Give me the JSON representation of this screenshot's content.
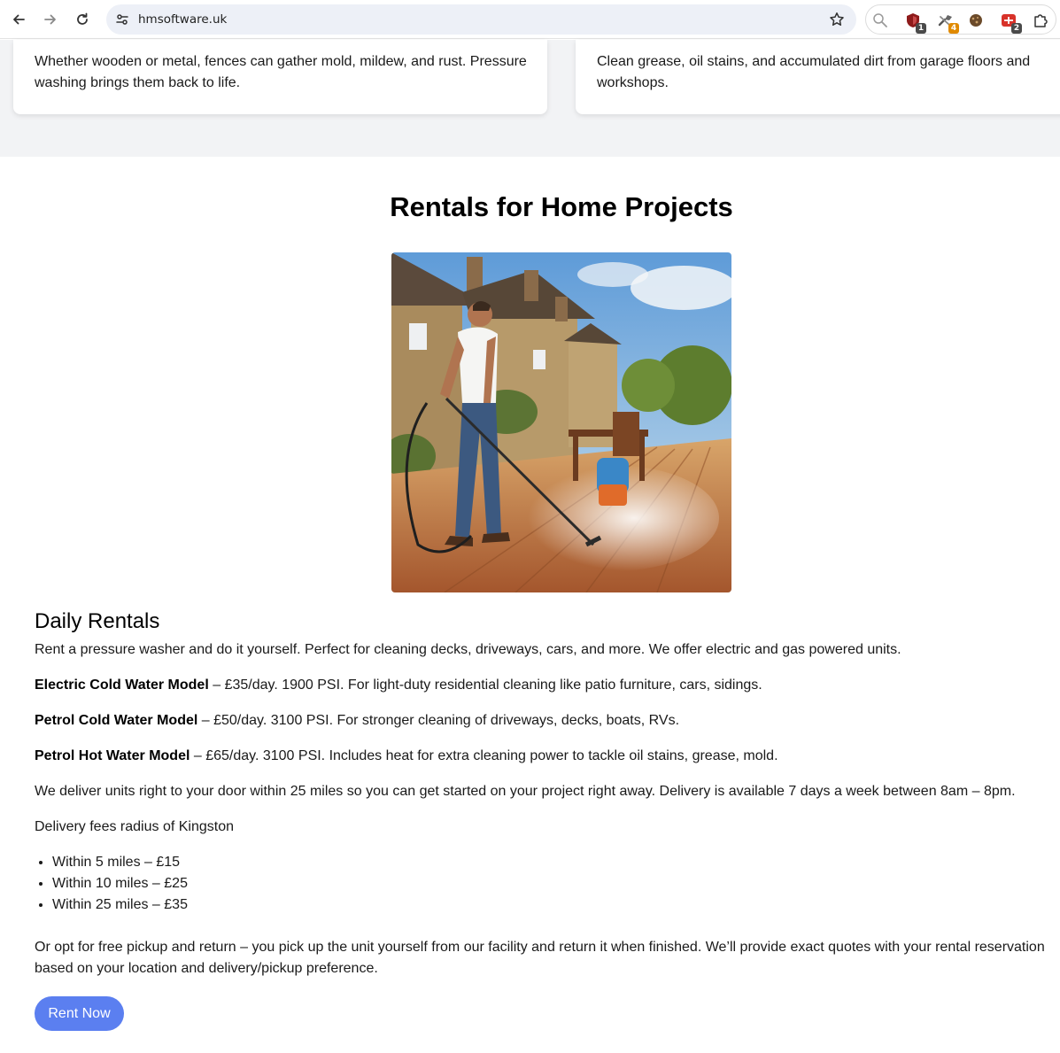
{
  "browser": {
    "url": "hmsoftware.uk",
    "back_icon": "back-arrow-icon",
    "forward_icon": "forward-arrow-icon",
    "reload_icon": "reload-icon",
    "site_info_icon": "site-settings-icon",
    "bookmark_icon": "star-icon",
    "extensions": [
      {
        "name": "search-extension-icon"
      },
      {
        "name": "shield-extension-icon",
        "badge": "1",
        "badge_color": "#4a4a4a"
      },
      {
        "name": "tools-extension-icon",
        "badge": "4",
        "badge_color": "#e08a00"
      },
      {
        "name": "cookie-extension-icon"
      },
      {
        "name": "red-extension-icon",
        "badge": "2",
        "badge_color": "#4a4a4a"
      },
      {
        "name": "puzzle-extensions-icon"
      }
    ]
  },
  "services": {
    "fences_text": "Whether wooden or metal, fences can gather mold, mildew, and rust. Pressure washing brings them back to life.",
    "garage_text": "Clean grease, oil stains, and accumulated dirt from garage floors and workshops."
  },
  "rentals": {
    "title": "Rentals for Home Projects",
    "image_alt": "Man pressure washing a wooden deck outside a stone cottage",
    "heading": "Daily Rentals",
    "intro": "Rent a pressure washer and do it yourself. Perfect for cleaning decks, driveways, cars, and more. We offer electric and gas powered units.",
    "models": [
      {
        "name": "Electric Cold Water Model",
        "detail": " – £35/day. 1900 PSI. For light-duty residential cleaning like patio furniture, cars, sidings."
      },
      {
        "name": "Petrol Cold Water Model",
        "detail": " – £50/day. 3100 PSI. For stronger cleaning of driveways, decks, boats, RVs."
      },
      {
        "name": "Petrol Hot Water Model",
        "detail": " – £65/day. 3100 PSI. Includes heat for extra cleaning power to tackle oil stains, grease, mold."
      }
    ],
    "delivery": "We deliver units right to your door within 25 miles so you can get started on your project right away. Delivery is available 7 days a week between 8am – 8pm.",
    "fees_heading": "Delivery fees radius of Kingston",
    "fees": [
      "Within 5 miles – £15",
      "Within 10 miles – £25",
      "Within 25 miles – £35"
    ],
    "pickup": "Or opt for free pickup and return – you pick up the unit yourself from our facility and return it when finished. We’ll provide exact quotes with your rental reservation based on your location and delivery/pickup preference.",
    "cta": "Rent Now",
    "cta_color": "#5b7ff0"
  }
}
